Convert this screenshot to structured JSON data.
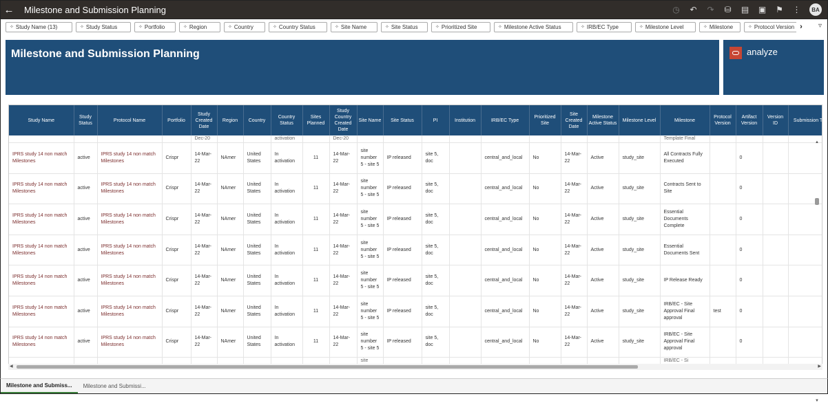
{
  "app": {
    "title": "Milestone and Submission Planning",
    "user_initials": "BA"
  },
  "filters": [
    "Study Name (13)",
    "Study Status",
    "Portfolio",
    "Region",
    "Country",
    "Country Status",
    "Site Name",
    "Site Status",
    "Prioritized Site",
    "Milestone Active Status",
    "IRB/EC Type",
    "Milestone Level",
    "Milestone",
    "Protocol Version"
  ],
  "banner": {
    "title": "Milestone and Submission Planning",
    "brand": "analyze"
  },
  "table": {
    "columns": [
      "Study Name",
      "Study Status",
      "Protocol Name",
      "Portfolio",
      "Study Created Date",
      "Region",
      "Country",
      "Country Status",
      "Sites Planned",
      "Study Country Created Date",
      "Site Name",
      "Site Status",
      "PI",
      "Institution",
      "IRB/EC Type",
      "Prioritized Site",
      "Site Created Date",
      "Milestone Active Status",
      "Milestone Level",
      "Milestone",
      "Protocol Version",
      "Artifact Version",
      "Version ID",
      "Submission Type"
    ],
    "partial_top": [
      "",
      "",
      "",
      "",
      "Dec-20",
      "",
      "",
      "activation",
      "",
      "Dec-20",
      "",
      "",
      "",
      "",
      "",
      "",
      "",
      "",
      "",
      "Template Final",
      "",
      "",
      "",
      ""
    ],
    "rows": [
      [
        "IPRS study 14 non match Milestones",
        "active",
        "IPRS study 14 non match Milestones",
        "Crispr",
        "14-Mar-22",
        "NAmer",
        "United States",
        "In activation",
        "11",
        "14-Mar-22",
        "site number 5 - site 5",
        "IP released",
        "site 5, doc",
        "",
        "central_and_local",
        "No",
        "14-Mar-22",
        "Active",
        "study_site",
        "All Contracts Fully Executed",
        "",
        "0",
        "",
        ""
      ],
      [
        "IPRS study 14 non match Milestones",
        "active",
        "IPRS study 14 non match Milestones",
        "Crispr",
        "14-Mar-22",
        "NAmer",
        "United States",
        "In activation",
        "11",
        "14-Mar-22",
        "site number 5 - site 5",
        "IP released",
        "site 5, doc",
        "",
        "central_and_local",
        "No",
        "14-Mar-22",
        "Active",
        "study_site",
        "Contracts Sent to Site",
        "",
        "0",
        "",
        ""
      ],
      [
        "IPRS study 14 non match Milestones",
        "active",
        "IPRS study 14 non match Milestones",
        "Crispr",
        "14-Mar-22",
        "NAmer",
        "United States",
        "In activation",
        "11",
        "14-Mar-22",
        "site number 5 - site 5",
        "IP released",
        "site 5, doc",
        "",
        "central_and_local",
        "No",
        "14-Mar-22",
        "Active",
        "study_site",
        "Essential Documents Complete",
        "",
        "0",
        "",
        ""
      ],
      [
        "IPRS study 14 non match Milestones",
        "active",
        "IPRS study 14 non match Milestones",
        "Crispr",
        "14-Mar-22",
        "NAmer",
        "United States",
        "In activation",
        "11",
        "14-Mar-22",
        "site number 5 - site 5",
        "IP released",
        "site 5, doc",
        "",
        "central_and_local",
        "No",
        "14-Mar-22",
        "Active",
        "study_site",
        "Essential Documents Sent",
        "",
        "0",
        "",
        ""
      ],
      [
        "IPRS study 14 non match Milestones",
        "active",
        "IPRS study 14 non match Milestones",
        "Crispr",
        "14-Mar-22",
        "NAmer",
        "United States",
        "In activation",
        "11",
        "14-Mar-22",
        "site number 5 - site 5",
        "IP released",
        "site 5, doc",
        "",
        "central_and_local",
        "No",
        "14-Mar-22",
        "Active",
        "study_site",
        "IP Release Ready",
        "",
        "0",
        "",
        ""
      ],
      [
        "IPRS study 14 non match Milestones",
        "active",
        "IPRS study 14 non match Milestones",
        "Crispr",
        "14-Mar-22",
        "NAmer",
        "United States",
        "In activation",
        "11",
        "14-Mar-22",
        "site number 5 - site 5",
        "IP released",
        "site 5, doc",
        "",
        "central_and_local",
        "No",
        "14-Mar-22",
        "Active",
        "study_site",
        "IRB/EC - Site Approval Final approval",
        "test",
        "0",
        "",
        ""
      ],
      [
        "IPRS study 14 non match Milestones",
        "active",
        "IPRS study 14 non match Milestones",
        "Crispr",
        "14-Mar-22",
        "NAmer",
        "United States",
        "In activation",
        "11",
        "14-Mar-22",
        "site number 5 - site 5",
        "IP released",
        "site 5, doc",
        "",
        "central_and_local",
        "No",
        "14-Mar-22",
        "Active",
        "study_site",
        "IRB/EC - Site Approval Final approval",
        "",
        "0",
        "",
        ""
      ]
    ],
    "partial_bottom": [
      "",
      "",
      "",
      "",
      "",
      "",
      "",
      "",
      "",
      "",
      "site",
      "",
      "",
      "",
      "",
      "",
      "",
      "",
      "",
      "IRB/EC - Si",
      "",
      "",
      "",
      ""
    ]
  },
  "tabs": [
    "Milestone and Submiss...",
    "Milestone and Submissi..."
  ],
  "colors": {
    "topbar": "#312d2a",
    "banner": "#1f4e79",
    "brand_logo": "#c74634",
    "link_text": "#7b2d2d"
  }
}
